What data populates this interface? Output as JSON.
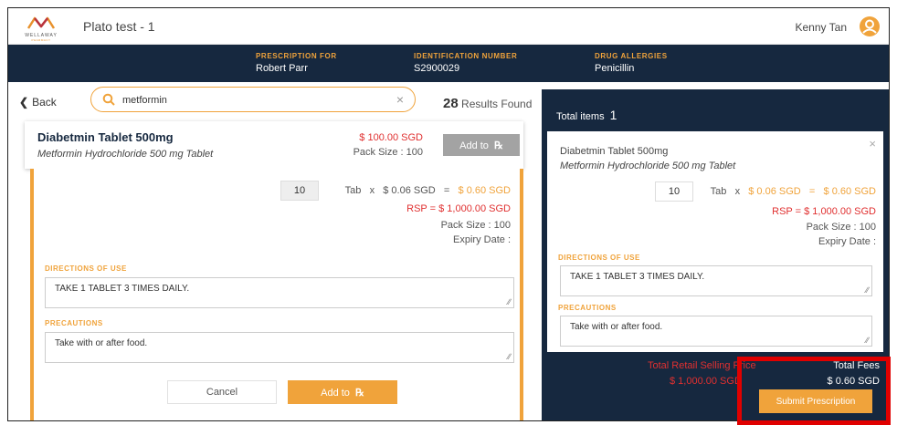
{
  "header": {
    "logo_text": "WELLAWAY",
    "logo_sub": "PHARMACY",
    "title": "Plato test - 1",
    "user_name": "Kenny Tan"
  },
  "patient": {
    "prescription_for_label": "PRESCRIPTION FOR",
    "prescription_for_value": "Robert Parr",
    "id_label": "IDENTIFICATION NUMBER",
    "id_value": "S2900029",
    "allergies_label": "DRUG ALLERGIES",
    "allergies_value": "Penicillin"
  },
  "search": {
    "back_label": "Back",
    "query": "metformin",
    "clear_icon": "×",
    "results_count": "28",
    "results_label": "Results Found"
  },
  "result": {
    "name": "Diabetmin Tablet 500mg",
    "generic": "Metformin Hydrochloride 500 mg Tablet",
    "price": "$ 100.00 SGD",
    "pack_size": "Pack Size : 100",
    "add_label": "Add to",
    "rx_symbol": "℞"
  },
  "detail": {
    "quantity": "10",
    "unit": "Tab",
    "times": "x",
    "unit_price": "$ 0.06 SGD",
    "equals": "=",
    "line_total": "$ 0.60 SGD",
    "rsp": "RSP =  $ 1,000.00 SGD",
    "pack_size": "Pack Size : 100",
    "expiry": "Expiry Date :",
    "directions_label": "DIRECTIONS OF USE",
    "directions_value": "TAKE 1 TABLET 3 TIMES DAILY.",
    "precautions_label": "PRECAUTIONS",
    "precautions_value": "Take with or after food.",
    "cancel_label": "Cancel",
    "add_label": "Add to"
  },
  "cart": {
    "total_items_label": "Total items",
    "total_items_value": "1",
    "close_icon": "×",
    "item_name": "Diabetmin Tablet 500mg",
    "item_generic": "Metformin Hydrochloride 500 mg Tablet",
    "quantity": "10",
    "unit": "Tab",
    "times": "x",
    "unit_price": "$ 0.06 SGD",
    "equals": "=",
    "line_total": "$ 0.60 SGD",
    "rsp": "RSP =  $ 1,000.00 SGD",
    "pack_size": "Pack Size : 100",
    "expiry": "Expiry Date :",
    "directions_label": "DIRECTIONS OF USE",
    "directions_value": "TAKE 1 TABLET 3 TIMES DAILY.",
    "precautions_label": "PRECAUTIONS",
    "precautions_value": "Take with or after food.",
    "total_rsp_label": "Total Retail Selling Price",
    "total_rsp_value": "$ 1,000.00 SGD",
    "total_fees_label": "Total Fees",
    "total_fees_value": "$ 0.60 SGD",
    "submit_label": "Submit Prescription"
  },
  "colors": {
    "navy": "#16283f",
    "orange": "#f0a33b",
    "red": "#e03030",
    "highlight": "#e00000"
  }
}
